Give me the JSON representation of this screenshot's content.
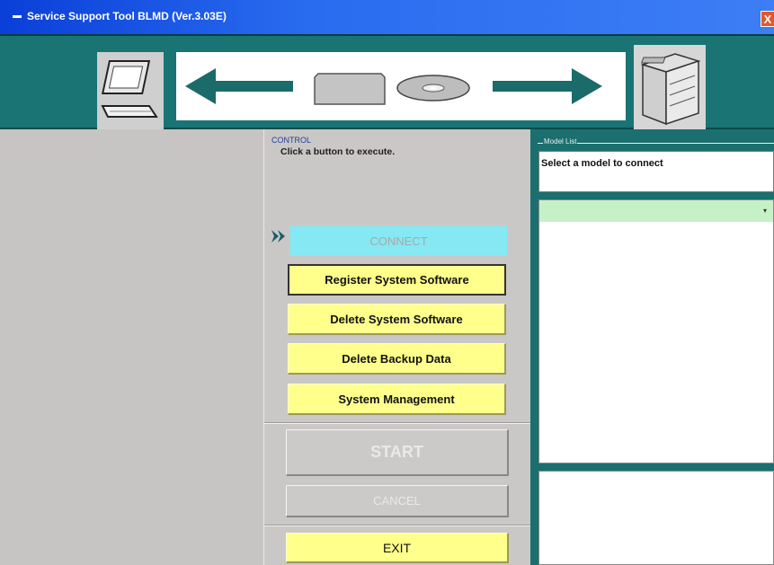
{
  "window": {
    "title": "Service Support Tool BLMD (Ver.3.03E)",
    "close_label": "X"
  },
  "banner": {
    "icons": [
      "laptop-icon",
      "arrow-left-icon",
      "memory-card-icon",
      "cd-rom-icon",
      "arrow-right-icon",
      "copier-icon"
    ]
  },
  "control": {
    "section_label": "CONTROL",
    "instruction": "Click a button to execute.",
    "buttons": {
      "connect": "CONNECT",
      "register": "Register System Software",
      "delete_system": "Delete System Software",
      "delete_backup": "Delete Backup Data",
      "system_management": "System Management",
      "start": "START",
      "cancel": "CANCEL",
      "exit": "EXIT"
    }
  },
  "model_list": {
    "label": "Model List",
    "message": "Select a model to connect",
    "dropdown_arrow": "▾"
  },
  "colors": {
    "titlebar": "#2a6cf0",
    "teal": "#1a7474",
    "button_yellow": "#ffff8c",
    "connect_cyan": "#86e8f2",
    "list_green": "#c6f1c6"
  }
}
